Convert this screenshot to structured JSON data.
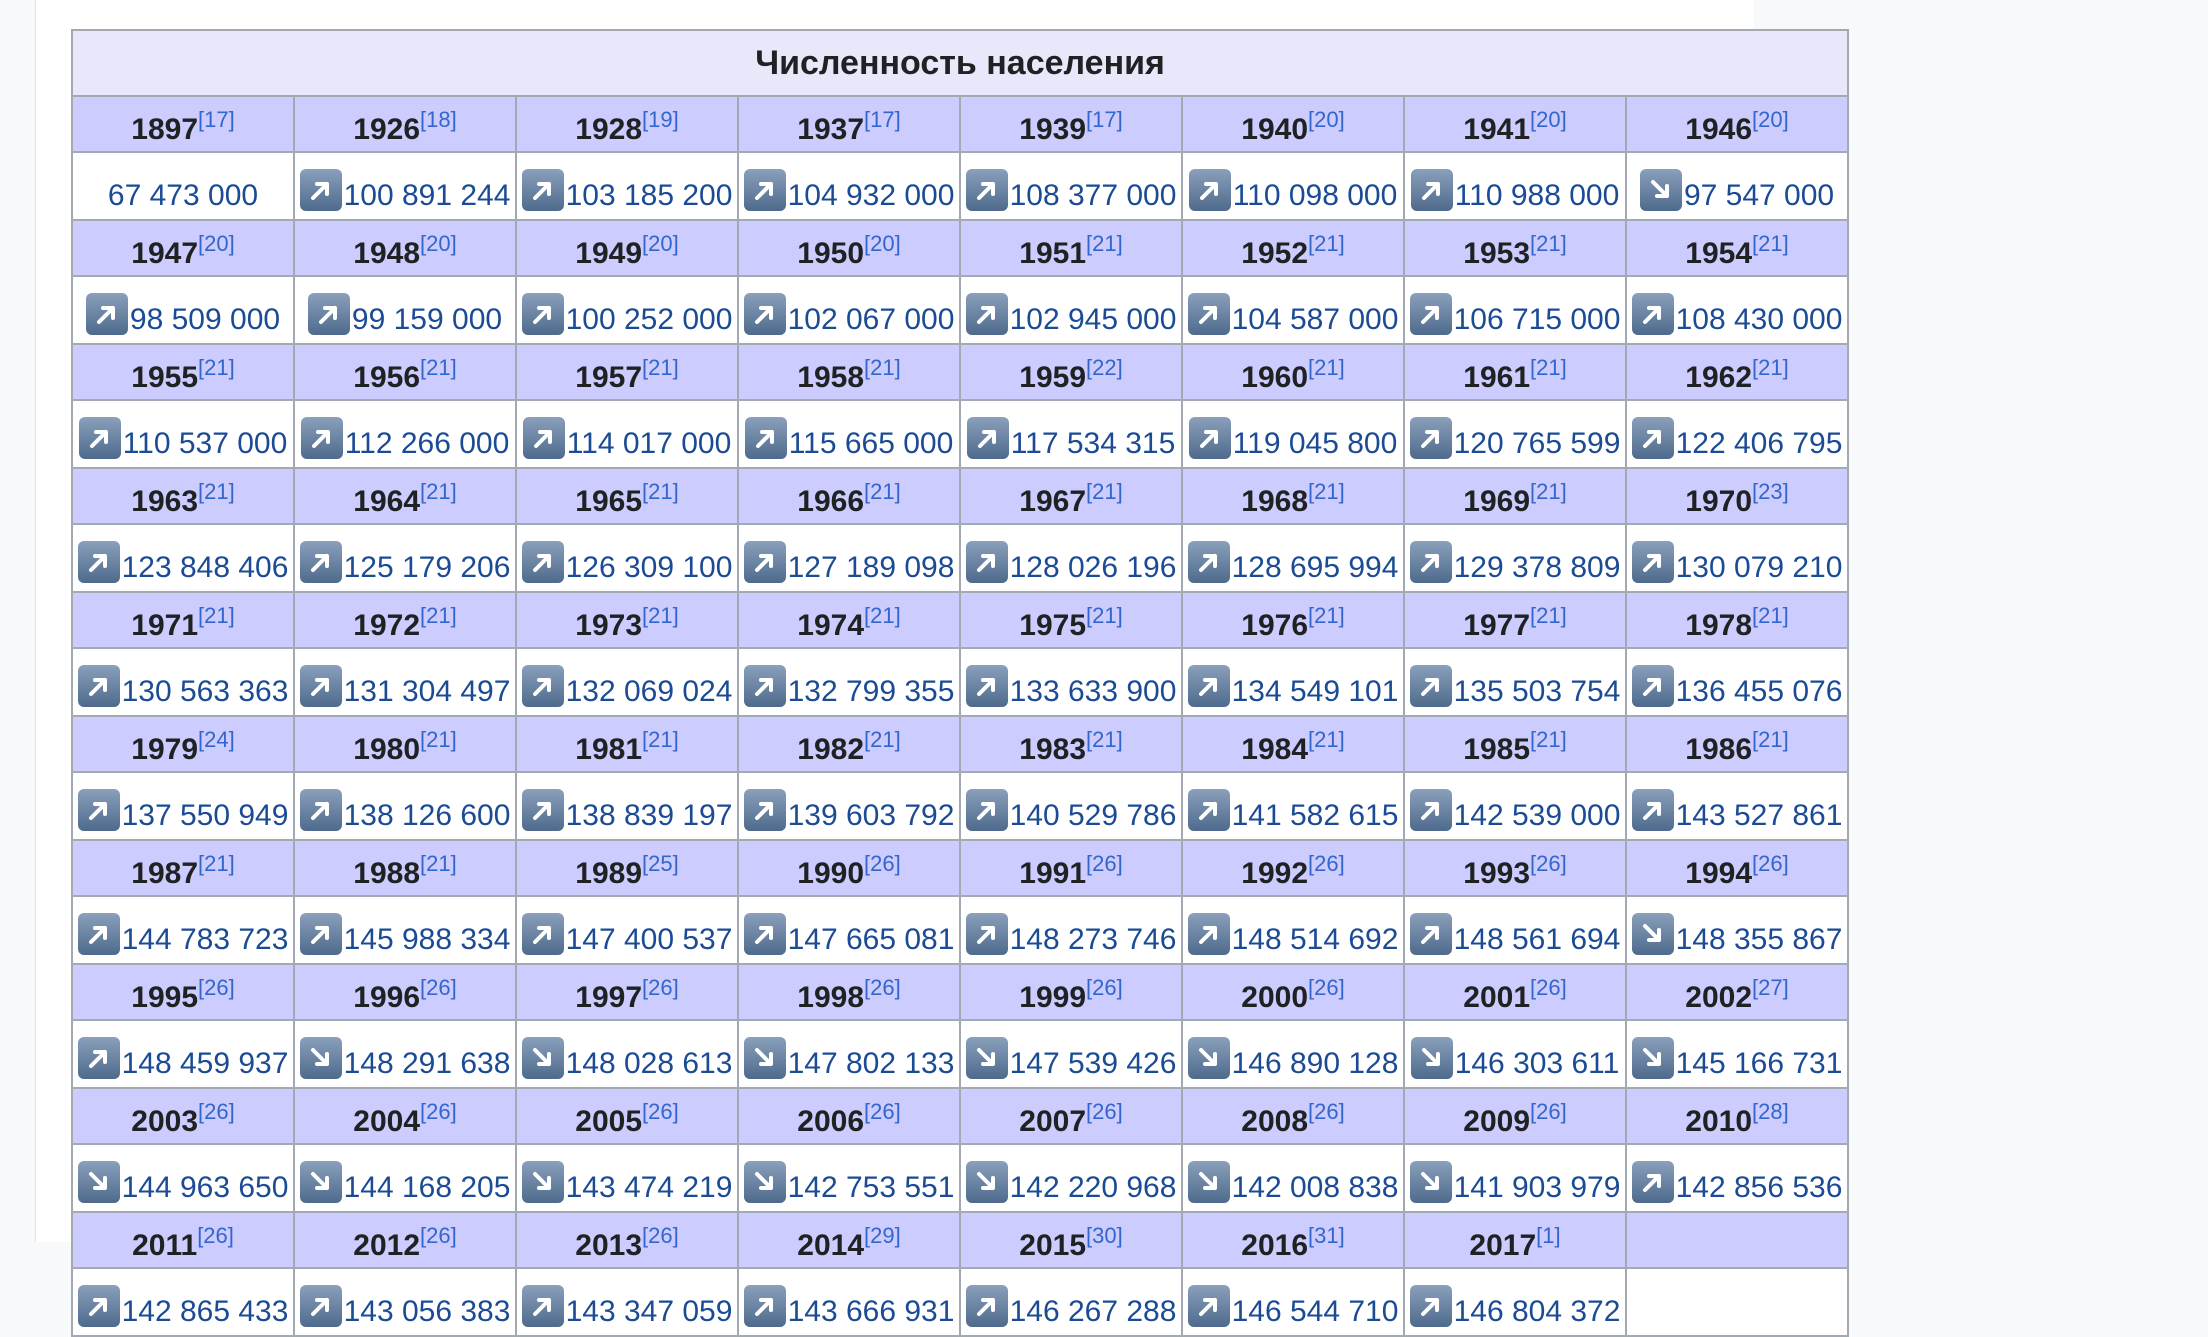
{
  "caption": "Численность населения",
  "rows": [
    [
      {
        "year": "1897",
        "ref": "[17]",
        "value": "67 473 000",
        "trend": "none"
      },
      {
        "year": "1926",
        "ref": "[18]",
        "value": "100 891 244",
        "trend": "up"
      },
      {
        "year": "1928",
        "ref": "[19]",
        "value": "103 185 200",
        "trend": "up"
      },
      {
        "year": "1937",
        "ref": "[17]",
        "value": "104 932 000",
        "trend": "up"
      },
      {
        "year": "1939",
        "ref": "[17]",
        "value": "108 377 000",
        "trend": "up"
      },
      {
        "year": "1940",
        "ref": "[20]",
        "value": "110 098 000",
        "trend": "up"
      },
      {
        "year": "1941",
        "ref": "[20]",
        "value": "110 988 000",
        "trend": "up"
      },
      {
        "year": "1946",
        "ref": "[20]",
        "value": "97 547 000",
        "trend": "down"
      }
    ],
    [
      {
        "year": "1947",
        "ref": "[20]",
        "value": "98 509 000",
        "trend": "up"
      },
      {
        "year": "1948",
        "ref": "[20]",
        "value": "99 159 000",
        "trend": "up"
      },
      {
        "year": "1949",
        "ref": "[20]",
        "value": "100 252 000",
        "trend": "up"
      },
      {
        "year": "1950",
        "ref": "[20]",
        "value": "102 067 000",
        "trend": "up"
      },
      {
        "year": "1951",
        "ref": "[21]",
        "value": "102 945 000",
        "trend": "up"
      },
      {
        "year": "1952",
        "ref": "[21]",
        "value": "104 587 000",
        "trend": "up"
      },
      {
        "year": "1953",
        "ref": "[21]",
        "value": "106 715 000",
        "trend": "up"
      },
      {
        "year": "1954",
        "ref": "[21]",
        "value": "108 430 000",
        "trend": "up"
      }
    ],
    [
      {
        "year": "1955",
        "ref": "[21]",
        "value": "110 537 000",
        "trend": "up"
      },
      {
        "year": "1956",
        "ref": "[21]",
        "value": "112 266 000",
        "trend": "up"
      },
      {
        "year": "1957",
        "ref": "[21]",
        "value": "114 017 000",
        "trend": "up"
      },
      {
        "year": "1958",
        "ref": "[21]",
        "value": "115 665 000",
        "trend": "up"
      },
      {
        "year": "1959",
        "ref": "[22]",
        "value": "117 534 315",
        "trend": "up"
      },
      {
        "year": "1960",
        "ref": "[21]",
        "value": "119 045 800",
        "trend": "up"
      },
      {
        "year": "1961",
        "ref": "[21]",
        "value": "120 765 599",
        "trend": "up"
      },
      {
        "year": "1962",
        "ref": "[21]",
        "value": "122 406 795",
        "trend": "up"
      }
    ],
    [
      {
        "year": "1963",
        "ref": "[21]",
        "value": "123 848 406",
        "trend": "up"
      },
      {
        "year": "1964",
        "ref": "[21]",
        "value": "125 179 206",
        "trend": "up"
      },
      {
        "year": "1965",
        "ref": "[21]",
        "value": "126 309 100",
        "trend": "up"
      },
      {
        "year": "1966",
        "ref": "[21]",
        "value": "127 189 098",
        "trend": "up"
      },
      {
        "year": "1967",
        "ref": "[21]",
        "value": "128 026 196",
        "trend": "up"
      },
      {
        "year": "1968",
        "ref": "[21]",
        "value": "128 695 994",
        "trend": "up"
      },
      {
        "year": "1969",
        "ref": "[21]",
        "value": "129 378 809",
        "trend": "up"
      },
      {
        "year": "1970",
        "ref": "[23]",
        "value": "130 079 210",
        "trend": "up"
      }
    ],
    [
      {
        "year": "1971",
        "ref": "[21]",
        "value": "130 563 363",
        "trend": "up"
      },
      {
        "year": "1972",
        "ref": "[21]",
        "value": "131 304 497",
        "trend": "up"
      },
      {
        "year": "1973",
        "ref": "[21]",
        "value": "132 069 024",
        "trend": "up"
      },
      {
        "year": "1974",
        "ref": "[21]",
        "value": "132 799 355",
        "trend": "up"
      },
      {
        "year": "1975",
        "ref": "[21]",
        "value": "133 633 900",
        "trend": "up"
      },
      {
        "year": "1976",
        "ref": "[21]",
        "value": "134 549 101",
        "trend": "up"
      },
      {
        "year": "1977",
        "ref": "[21]",
        "value": "135 503 754",
        "trend": "up"
      },
      {
        "year": "1978",
        "ref": "[21]",
        "value": "136 455 076",
        "trend": "up"
      }
    ],
    [
      {
        "year": "1979",
        "ref": "[24]",
        "value": "137 550 949",
        "trend": "up"
      },
      {
        "year": "1980",
        "ref": "[21]",
        "value": "138 126 600",
        "trend": "up"
      },
      {
        "year": "1981",
        "ref": "[21]",
        "value": "138 839 197",
        "trend": "up"
      },
      {
        "year": "1982",
        "ref": "[21]",
        "value": "139 603 792",
        "trend": "up"
      },
      {
        "year": "1983",
        "ref": "[21]",
        "value": "140 529 786",
        "trend": "up"
      },
      {
        "year": "1984",
        "ref": "[21]",
        "value": "141 582 615",
        "trend": "up"
      },
      {
        "year": "1985",
        "ref": "[21]",
        "value": "142 539 000",
        "trend": "up"
      },
      {
        "year": "1986",
        "ref": "[21]",
        "value": "143 527 861",
        "trend": "up"
      }
    ],
    [
      {
        "year": "1987",
        "ref": "[21]",
        "value": "144 783 723",
        "trend": "up"
      },
      {
        "year": "1988",
        "ref": "[21]",
        "value": "145 988 334",
        "trend": "up"
      },
      {
        "year": "1989",
        "ref": "[25]",
        "value": "147 400 537",
        "trend": "up"
      },
      {
        "year": "1990",
        "ref": "[26]",
        "value": "147 665 081",
        "trend": "up"
      },
      {
        "year": "1991",
        "ref": "[26]",
        "value": "148 273 746",
        "trend": "up"
      },
      {
        "year": "1992",
        "ref": "[26]",
        "value": "148 514 692",
        "trend": "up"
      },
      {
        "year": "1993",
        "ref": "[26]",
        "value": "148 561 694",
        "trend": "up"
      },
      {
        "year": "1994",
        "ref": "[26]",
        "value": "148 355 867",
        "trend": "down"
      }
    ],
    [
      {
        "year": "1995",
        "ref": "[26]",
        "value": "148 459 937",
        "trend": "up"
      },
      {
        "year": "1996",
        "ref": "[26]",
        "value": "148 291 638",
        "trend": "down"
      },
      {
        "year": "1997",
        "ref": "[26]",
        "value": "148 028 613",
        "trend": "down"
      },
      {
        "year": "1998",
        "ref": "[26]",
        "value": "147 802 133",
        "trend": "down"
      },
      {
        "year": "1999",
        "ref": "[26]",
        "value": "147 539 426",
        "trend": "down"
      },
      {
        "year": "2000",
        "ref": "[26]",
        "value": "146 890 128",
        "trend": "down"
      },
      {
        "year": "2001",
        "ref": "[26]",
        "value": "146 303 611",
        "trend": "down"
      },
      {
        "year": "2002",
        "ref": "[27]",
        "value": "145 166 731",
        "trend": "down"
      }
    ],
    [
      {
        "year": "2003",
        "ref": "[26]",
        "value": "144 963 650",
        "trend": "down"
      },
      {
        "year": "2004",
        "ref": "[26]",
        "value": "144 168 205",
        "trend": "down"
      },
      {
        "year": "2005",
        "ref": "[26]",
        "value": "143 474 219",
        "trend": "down"
      },
      {
        "year": "2006",
        "ref": "[26]",
        "value": "142 753 551",
        "trend": "down"
      },
      {
        "year": "2007",
        "ref": "[26]",
        "value": "142 220 968",
        "trend": "down"
      },
      {
        "year": "2008",
        "ref": "[26]",
        "value": "142 008 838",
        "trend": "down"
      },
      {
        "year": "2009",
        "ref": "[26]",
        "value": "141 903 979",
        "trend": "down"
      },
      {
        "year": "2010",
        "ref": "[28]",
        "value": "142 856 536",
        "trend": "up"
      }
    ],
    [
      {
        "year": "2011",
        "ref": "[26]",
        "value": "142 865 433",
        "trend": "up"
      },
      {
        "year": "2012",
        "ref": "[26]",
        "value": "143 056 383",
        "trend": "up"
      },
      {
        "year": "2013",
        "ref": "[26]",
        "value": "143 347 059",
        "trend": "up"
      },
      {
        "year": "2014",
        "ref": "[29]",
        "value": "143 666 931",
        "trend": "up"
      },
      {
        "year": "2015",
        "ref": "[30]",
        "value": "146 267 288",
        "trend": "up"
      },
      {
        "year": "2016",
        "ref": "[31]",
        "value": "146 544 710",
        "trend": "up"
      },
      {
        "year": "2017",
        "ref": "[1]",
        "value": "146 804 372",
        "trend": "up"
      },
      {
        "year": "",
        "ref": "",
        "value": "",
        "trend": "empty"
      }
    ]
  ],
  "icons": {
    "up": "increase-arrow-icon",
    "down": "decrease-arrow-icon"
  }
}
